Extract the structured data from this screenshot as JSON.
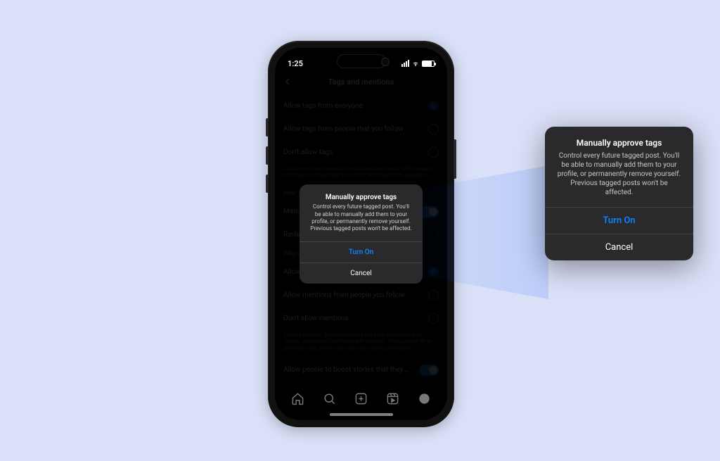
{
  "status": {
    "time": "1:25"
  },
  "header": {
    "title": "Tags and mentions"
  },
  "tags": {
    "opt1": "Allow tags from everyone",
    "opt2": "Allow tags from people that you follow",
    "opt3": "Don't allow tags",
    "desc": "Choose who can tag you in their photos and reels. When people try to tag you, they'll see if you don't allow tags from everyone."
  },
  "approve": {
    "header": "How you manage tags",
    "row1": "Manually approve tags",
    "row2": "Review tags"
  },
  "mentions": {
    "header": "Who can @mention you",
    "opt1": "Allow mentions from everyone",
    "opt2": "Allow mentions from people you follow",
    "opt3": "Don't allow mentions",
    "desc": "Choose who can @mention you to link your account in their stories, comments, live videos and captions. When people try to @mention you, they'll see if you don't allow @mentions."
  },
  "boost": {
    "row": "Allow people to boost stories that they..."
  },
  "alert": {
    "title": "Manually approve tags",
    "body": "Control every future tagged post. You'll be able to manually add them to your profile, or permanently remove yourself. Previous tagged posts won't be affected.",
    "primary": "Turn On",
    "secondary": "Cancel"
  }
}
